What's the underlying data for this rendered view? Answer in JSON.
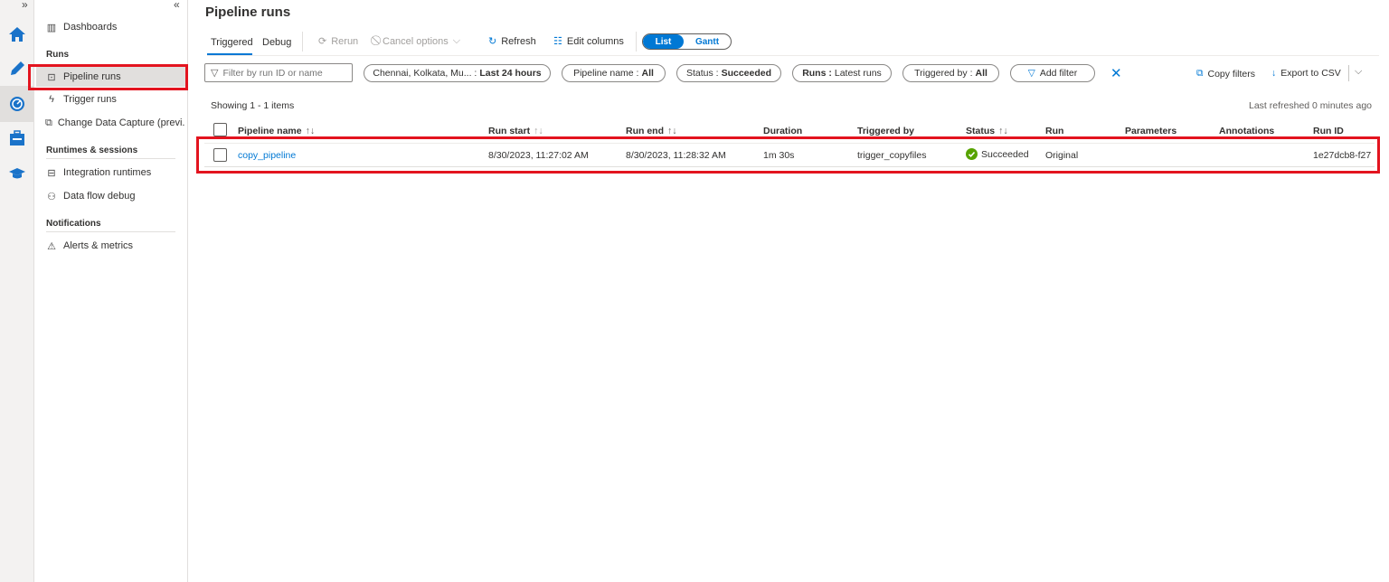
{
  "rail": {
    "expand": "»",
    "items": [
      {
        "icon": "home-icon"
      },
      {
        "icon": "pencil-icon"
      },
      {
        "icon": "monitor-icon"
      },
      {
        "icon": "toolbox-icon"
      },
      {
        "icon": "learn-icon"
      }
    ]
  },
  "sidebar": {
    "collapse": "«",
    "dashboards": "Dashboards",
    "runs_header": "Runs",
    "pipeline_runs": "Pipeline runs",
    "trigger_runs": "Trigger runs",
    "cdc": "Change Data Capture (previ...",
    "runtimes_header": "Runtimes & sessions",
    "integration_runtimes": "Integration runtimes",
    "data_flow_debug": "Data flow debug",
    "notifications_header": "Notifications",
    "alerts": "Alerts & metrics"
  },
  "main": {
    "title": "Pipeline runs",
    "tabs": [
      "Triggered",
      "Debug"
    ],
    "toolbar": {
      "rerun": "Rerun",
      "cancel": "Cancel options",
      "refresh": "Refresh",
      "edit_columns": "Edit columns",
      "list": "List",
      "gantt": "Gantt"
    },
    "search_placeholder": "Filter by run ID or name",
    "filters": [
      {
        "label": "Chennai, Kolkata, Mu... :",
        "value": "Last 24 hours"
      },
      {
        "label": "Pipeline name :",
        "value": "All"
      },
      {
        "label": "Status :",
        "value": "Succeeded"
      },
      {
        "label": "Runs :",
        "value": "Latest runs"
      },
      {
        "label": "Triggered by :",
        "value": "All"
      }
    ],
    "add_filter": "Add filter",
    "copy_filters": "Copy filters",
    "export_csv": "Export to CSV",
    "showing": "Showing 1 - 1 items",
    "last_refreshed": "Last refreshed 0 minutes ago",
    "columns": [
      "Pipeline name",
      "Run start",
      "Run end",
      "Duration",
      "Triggered by",
      "Status",
      "Run",
      "Parameters",
      "Annotations",
      "Run ID"
    ],
    "rows": [
      {
        "pipeline": "copy_pipeline",
        "run_start": "8/30/2023, 11:27:02 AM",
        "run_end": "8/30/2023, 11:28:32 AM",
        "duration": "1m 30s",
        "triggered_by": "trigger_copyfiles",
        "status": "Succeeded",
        "run": "Original",
        "parameters": "",
        "annotations": "",
        "run_id": "1e27dcb8-f27"
      }
    ],
    "colors": {
      "accent": "#0078d4",
      "success": "#57a300",
      "highlight": "#e3141f"
    }
  }
}
